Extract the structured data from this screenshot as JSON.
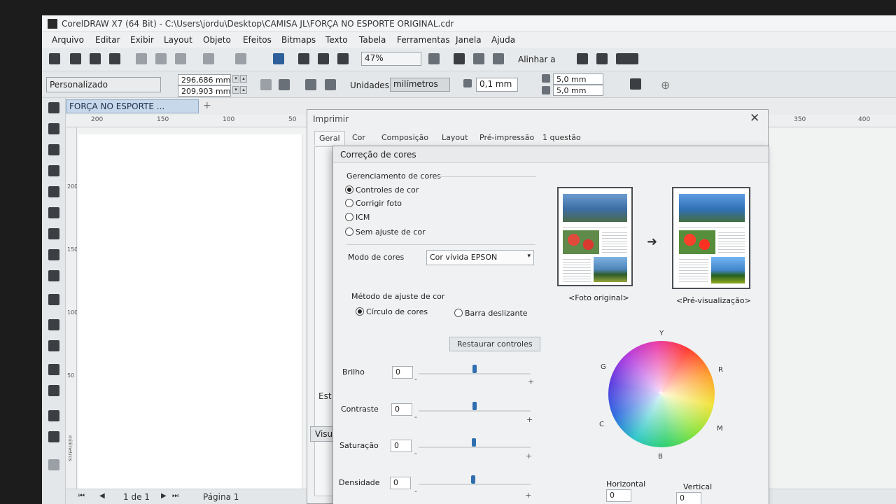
{
  "window": {
    "title": "CorelDRAW X7 (64 Bit) - C:\\Users\\jordu\\Desktop\\CAMISA JL\\FORÇA NO ESPORTE ORIGINAL.cdr"
  },
  "menu": [
    "Arquivo",
    "Editar",
    "Exibir",
    "Layout",
    "Objeto",
    "Efeitos",
    "Bitmaps",
    "Texto",
    "Tabela",
    "Ferramentas",
    "Janela",
    "Ajuda"
  ],
  "toolbar": {
    "zoom": "47%",
    "align_label": "Alinhar a",
    "page_preset": "Personalizado",
    "width": "296,686 mm",
    "height": "209,903 mm",
    "units_label": "Unidades:",
    "units_value": "milímetros",
    "nudge": "0,1 mm",
    "dup_x": "5,0 mm",
    "dup_y": "5,0 mm"
  },
  "document": {
    "tab": "FORÇA NO ESPORTE ...",
    "ruler_h": [
      "200",
      "150",
      "100",
      "50",
      "350",
      "400"
    ],
    "ruler_v": [
      "200",
      "150",
      "100",
      "50"
    ],
    "ruler_unit": "milímetros"
  },
  "status": {
    "page_count": "1 de 1",
    "page_name": "Página 1"
  },
  "print_dialog": {
    "title": "Imprimir",
    "tabs": [
      "Geral",
      "Cor",
      "Composição",
      "Layout",
      "Pré-impressão",
      "1 questão"
    ],
    "partial_est": "Est",
    "partial_visu": "Visu"
  },
  "color_dialog": {
    "title": "Correção de cores",
    "section": "Gerenciamento de cores",
    "options": [
      {
        "label": "Controles de cor",
        "selected": true
      },
      {
        "label": "Corrigir foto",
        "selected": false
      },
      {
        "label": "ICM",
        "selected": false
      },
      {
        "label": "Sem ajuste de cor",
        "selected": false
      }
    ],
    "mode_label": "Modo de cores",
    "mode_value": "Cor vívida EPSON",
    "method_label": "Método de ajuste de cor",
    "method_options": [
      {
        "label": "Círculo de cores",
        "selected": true
      },
      {
        "label": "Barra deslizante",
        "selected": false
      }
    ],
    "restore_button": "Restaurar controles",
    "sliders": [
      {
        "label": "Brilho",
        "value": "0"
      },
      {
        "label": "Contraste",
        "value": "0"
      },
      {
        "label": "Saturação",
        "value": "0"
      },
      {
        "label": "Densidade",
        "value": "0"
      }
    ],
    "preview_original": "<Foto original>",
    "preview_after": "<Pré-visualização>",
    "wheel_labels": {
      "y": "Y",
      "r": "R",
      "m": "M",
      "b": "B",
      "c": "C",
      "g": "G"
    },
    "horizontal_label": "Horizontal",
    "horizontal_value": "0",
    "vertical_label": "Vertical",
    "vertical_value": "0"
  }
}
